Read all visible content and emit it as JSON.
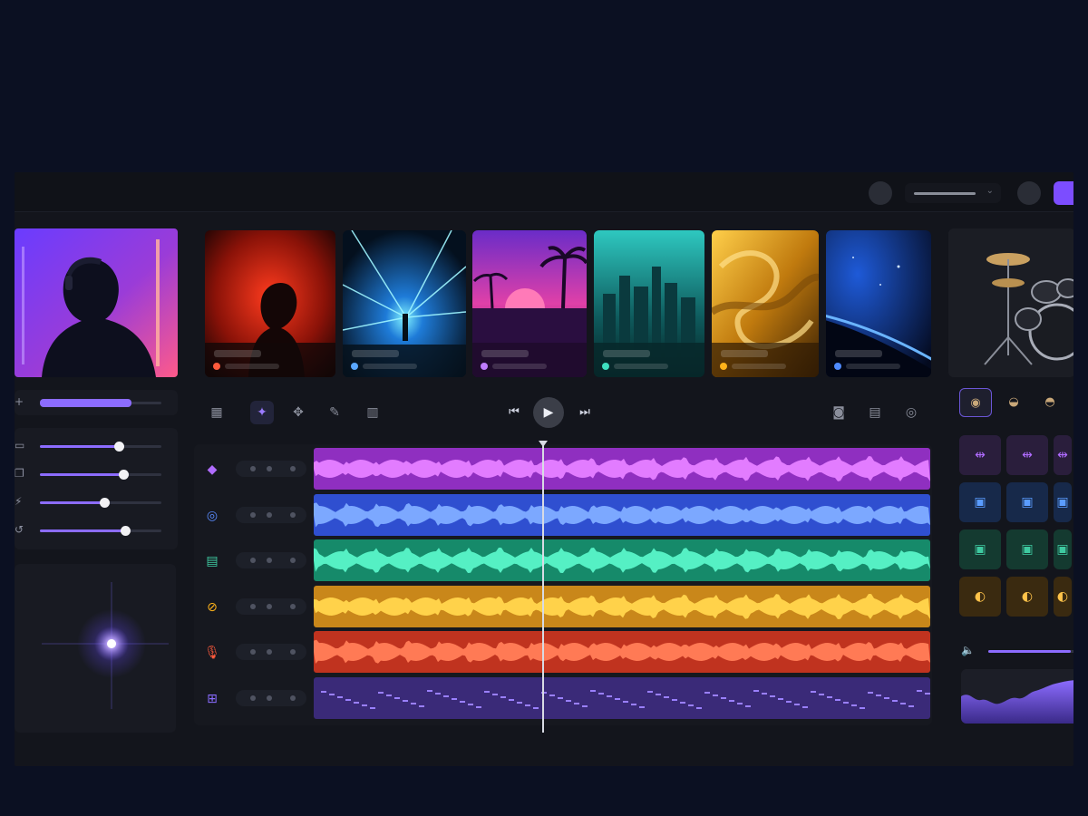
{
  "colors": {
    "accent": "#7c4dff",
    "track_purple": "#8f2fc0",
    "track_blue": "#2f4fd0",
    "track_teal": "#168a6a",
    "track_orange": "#c9871a",
    "track_red": "#c0331f",
    "track_violet": "#3a2a78"
  },
  "topbar": {
    "icons": [
      "settings-icon",
      "dropdown-chevron-icon",
      "user-icon"
    ]
  },
  "left": {
    "sliders": [
      {
        "icon": "plus-icon",
        "value": 0.75
      },
      {
        "icon": "monitor-icon",
        "value": 0.65
      },
      {
        "icon": "stack-icon",
        "value": 0.69
      },
      {
        "icon": "bolt-icon",
        "value": 0.53
      },
      {
        "icon": "loop-icon",
        "value": 0.7
      }
    ]
  },
  "thumbnails": [
    {
      "name": "thumb-red-silhouette",
      "dot": "#ff5a3c"
    },
    {
      "name": "thumb-blue-lasers",
      "dot": "#5aa8ff"
    },
    {
      "name": "thumb-synthwave-palms",
      "dot": "#c07cff"
    },
    {
      "name": "thumb-teal-city",
      "dot": "#3ee0c0"
    },
    {
      "name": "thumb-golden-swirl",
      "dot": "#ffb31a"
    },
    {
      "name": "thumb-blue-planet",
      "dot": "#4f8bff"
    }
  ],
  "transport": {
    "tools": [
      "grid-icon",
      "sparkle-icon",
      "move-icon",
      "pencil-icon",
      "chart-icon"
    ],
    "controls": [
      "skip-back-icon",
      "play-icon",
      "skip-forward-icon"
    ],
    "right_tools": [
      "camera-icon",
      "panel-icon",
      "target-icon"
    ]
  },
  "tracks": [
    {
      "name": "synth-lead",
      "icon": "diamond-icon",
      "icon_color": "#b06cff",
      "color": "#8f2fc0",
      "wave": "#e27cff"
    },
    {
      "name": "bass",
      "icon": "disc-icon",
      "icon_color": "#5a8cff",
      "color": "#2f4fd0",
      "wave": "#7ca8ff"
    },
    {
      "name": "keys",
      "icon": "keyboard-icon",
      "icon_color": "#3ec9a0",
      "color": "#168a6a",
      "wave": "#55f0c4"
    },
    {
      "name": "guitar",
      "icon": "guitar-icon",
      "icon_color": "#ffb31a",
      "color": "#c9871a",
      "wave": "#ffd24a"
    },
    {
      "name": "vocals",
      "icon": "mic-icon",
      "icon_color": "#ff5a3c",
      "color": "#c0331f",
      "wave": "#ff7a55"
    },
    {
      "name": "drums",
      "icon": "grid-pads-icon",
      "icon_color": "#8a6cff",
      "color": "#3a2a78",
      "wave": "#9a80ff"
    }
  ],
  "right": {
    "kit_tabs": [
      "hihat-icon",
      "snare-icon",
      "cymbal-icon"
    ],
    "volume": 0.95
  }
}
